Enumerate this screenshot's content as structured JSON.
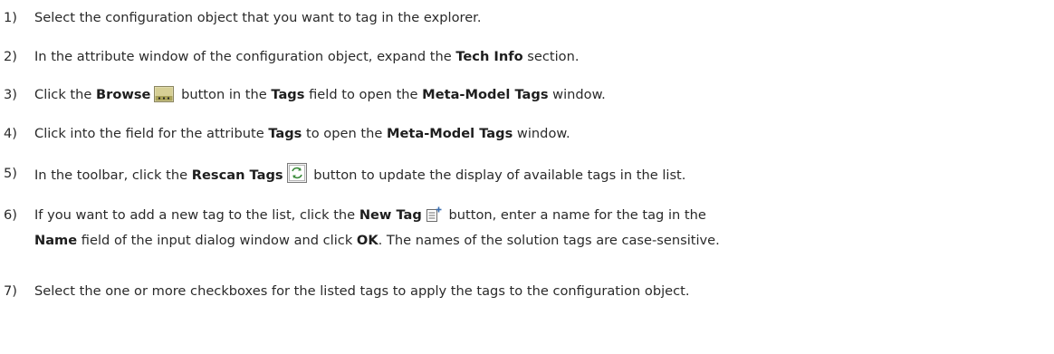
{
  "steps": [
    {
      "num": "1)",
      "text": "Select the configuration object that you want to tag in the explorer."
    },
    {
      "num": "2)",
      "pre": "In the attribute window of the configuration object, expand the ",
      "b1": "Tech Info",
      "post": " section."
    },
    {
      "num": "3)",
      "t1": "Click the ",
      "b1": "Browse",
      "t2": " button in the ",
      "b2": "Tags",
      "t3": " field to open the ",
      "b3": "Meta-Model Tags",
      "t4": " window.",
      "icon": "browse-button-icon"
    },
    {
      "num": "4)",
      "t1": "Click into the field for the attribute ",
      "b1": "Tags",
      "t2": " to open the ",
      "b2": "Meta-Model Tags",
      "t3": " window."
    },
    {
      "num": "5)",
      "t1": "In the toolbar, click the ",
      "b1": "Rescan Tags",
      "t2": " button to update the display of available tags in the list.",
      "icon": "rescan-tags-icon"
    },
    {
      "num": "6)",
      "t1": "If you want to add a new tag to the list, click the ",
      "b1": "New Tag",
      "t2": " button, enter a name for the tag in the",
      "b2": "Name",
      "t3": " field of the input dialog window and click ",
      "b3": "OK",
      "t4": ". The names of the solution tags are case-sensitive.",
      "icon": "new-tag-icon"
    },
    {
      "num": "7)",
      "text": "Select the one or more checkboxes for the listed tags to apply the tags to the configuration object."
    }
  ],
  "colors": {
    "text": "#2a2a2a",
    "browse_icon_bg": "#c9c27a",
    "rescan_icon_accent": "#3a8a3a",
    "new_tag_icon_accent": "#3c6fb0"
  }
}
